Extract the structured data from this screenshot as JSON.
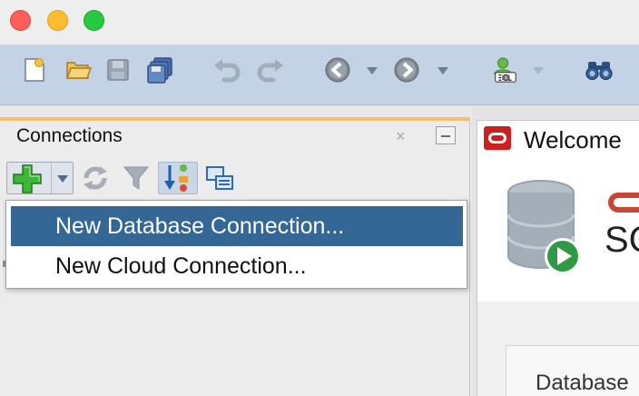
{
  "connections_panel": {
    "title": "Connections",
    "close_glyph": "×",
    "buttons": [
      {
        "icon": "add-icon"
      },
      {
        "icon": "refresh-icon"
      },
      {
        "icon": "filter-icon"
      },
      {
        "icon": "schema-toggle-icon"
      },
      {
        "icon": "connections-icon"
      }
    ]
  },
  "dropdown_menu": {
    "items": [
      {
        "label": "New Database Connection...",
        "selected": true
      },
      {
        "label": "New Cloud Connection...",
        "selected": false
      }
    ]
  },
  "welcome": {
    "tab_title": "Welcome",
    "product_fragment": "SC",
    "section_fragment": "Database"
  },
  "toolbar": {
    "buttons": [
      {
        "icon": "new-file-icon"
      },
      {
        "icon": "open-folder-icon"
      },
      {
        "icon": "save-icon"
      },
      {
        "icon": "save-all-icon"
      },
      {
        "icon": "undo-icon"
      },
      {
        "icon": "redo-icon"
      },
      {
        "icon": "back-icon"
      },
      {
        "icon": "forward-icon"
      },
      {
        "icon": "sql-worksheet-icon"
      },
      {
        "icon": "find-binoculars-icon"
      }
    ]
  },
  "colors": {
    "toolbar_bg": "#c3d2e4",
    "menu_selected_bg": "#346796",
    "panel_active_accent": "#f4c06a",
    "oracle_red": "#c74634"
  }
}
